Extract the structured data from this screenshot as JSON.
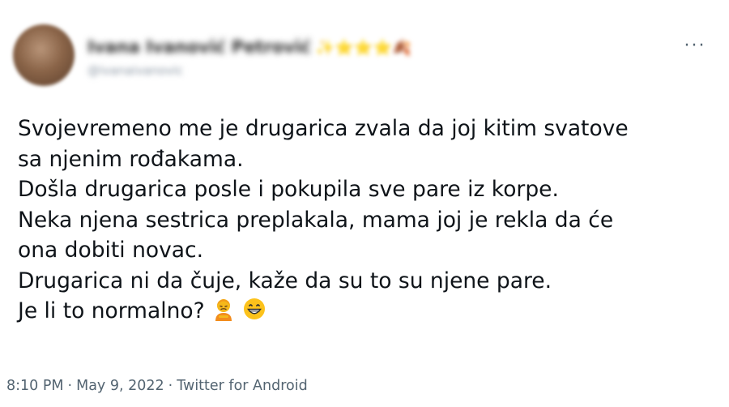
{
  "tweet": {
    "author": {
      "display_name": "Ivana Ivanović Petrović",
      "name_emojis": "✨⭐⭐⭐🍂",
      "handle": "@ivanaivanovic"
    },
    "more_icon": "more-horizontal-icon",
    "lines": [
      "Svojevremeno me je drugarica zvala da joj kitim svatove",
      "sa njenim rođakama.",
      "Došla drugarica posle i pokupila sve pare iz korpe.",
      "Neka njena sestrica preplakala, mama joj je rekla da će",
      "ona dobiti novac.",
      "Drugarica ni da čuje, kaže da su to su njene pare.",
      "Je li to normalno?"
    ],
    "emojis": [
      "person-pouting-icon",
      "grinning-face-icon"
    ],
    "footer": {
      "time": "8:10 PM",
      "separator": "·",
      "date": "May 9, 2022",
      "source": "Twitter for Android"
    }
  }
}
